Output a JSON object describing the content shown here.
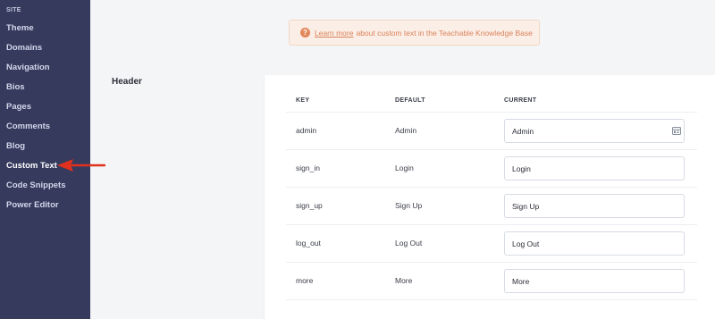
{
  "sidebar": {
    "heading": "SITE",
    "items": [
      {
        "label": "Theme"
      },
      {
        "label": "Domains"
      },
      {
        "label": "Navigation"
      },
      {
        "label": "Bios"
      },
      {
        "label": "Pages"
      },
      {
        "label": "Comments"
      },
      {
        "label": "Blog"
      },
      {
        "label": "Custom Text",
        "active": true
      },
      {
        "label": "Code Snippets"
      },
      {
        "label": "Power Editor"
      }
    ]
  },
  "banner": {
    "icon": "help-circle-icon",
    "link_text": "Learn more",
    "text": "about custom text in the Teachable Knowledge Base",
    "color": "#d9835b",
    "background": "#fbeee6"
  },
  "section": {
    "label": "Header"
  },
  "table": {
    "columns": [
      "KEY",
      "DEFAULT",
      "CURRENT"
    ],
    "rows": [
      {
        "key": "admin",
        "default": "Admin",
        "current": "Admin"
      },
      {
        "key": "sign_in",
        "default": "Login",
        "current": "Login"
      },
      {
        "key": "sign_up",
        "default": "Sign Up",
        "current": "Sign Up"
      },
      {
        "key": "log_out",
        "default": "Log Out",
        "current": "Log Out"
      },
      {
        "key": "more",
        "default": "More",
        "current": "More"
      }
    ]
  },
  "colors": {
    "sidebar_bg": "#363b5e",
    "annotation_arrow": "#e0301e"
  }
}
